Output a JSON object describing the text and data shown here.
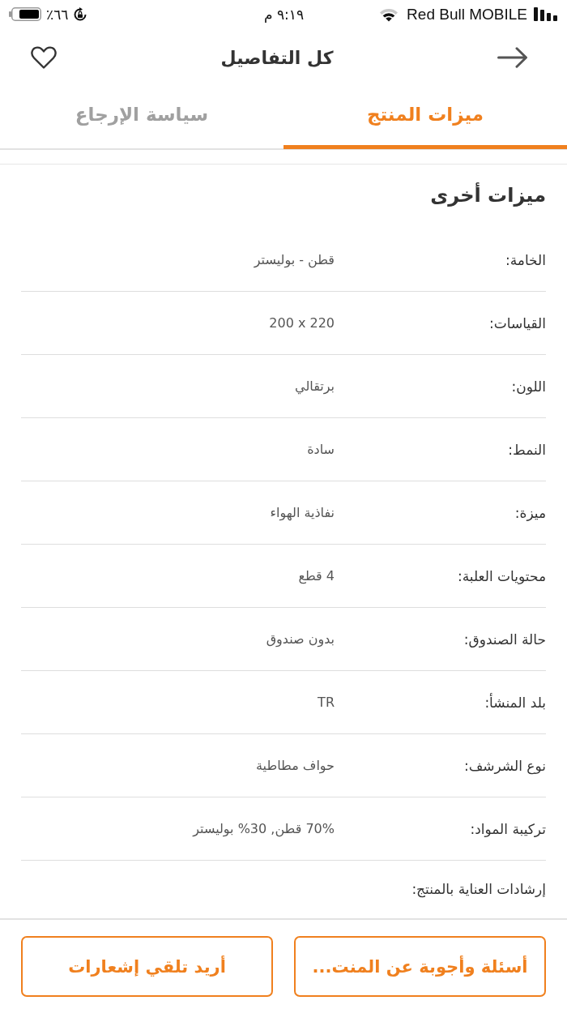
{
  "status_bar": {
    "battery_percent": "٦٦٪",
    "time": "٩:١٩ م",
    "carrier": "Red Bull MOBILE"
  },
  "header": {
    "title": "كل التفاصيل"
  },
  "tabs": [
    {
      "label": "ميزات المنتج",
      "selected": true
    },
    {
      "label": "سياسة الإرجاع",
      "selected": false
    }
  ],
  "section": {
    "title": "ميزات أخرى",
    "rows": [
      {
        "label": "الخامة:",
        "value": "قطن - بوليستر"
      },
      {
        "label": "القياسات:",
        "value": "200 x 220"
      },
      {
        "label": "اللون:",
        "value": "برتقالي"
      },
      {
        "label": "النمط:",
        "value": "سادة"
      },
      {
        "label": "ميزة:",
        "value": "نفاذية الهواء"
      },
      {
        "label": "محتويات العلبة:",
        "value": "4 قطع"
      },
      {
        "label": "حالة الصندوق:",
        "value": "بدون صندوق"
      },
      {
        "label": "بلد المنشأ:",
        "value": "TR"
      },
      {
        "label": "نوع الشرشف:",
        "value": "حواف مطاطية"
      },
      {
        "label": "تركيبة المواد:",
        "value": "70% قطن, 30% بوليستر"
      },
      {
        "label": "إرشادات العناية بالمنتج:"
      }
    ]
  },
  "buttons": [
    {
      "label": "أسئلة وأجوبة عن المنت..."
    },
    {
      "label": "أريد تلقي إشعارات"
    }
  ]
}
